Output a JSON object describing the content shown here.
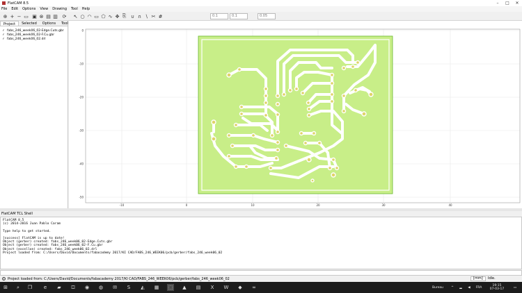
{
  "window": {
    "title": "FlatCAM 8.5"
  },
  "menu": [
    "File",
    "Edit",
    "Options",
    "View",
    "Drawing",
    "Tool",
    "Help"
  ],
  "toolbar": {
    "tools": [
      {
        "name": "zoom-fit-icon",
        "glyph": "⊕"
      },
      {
        "name": "zoom-in-icon",
        "glyph": "+"
      },
      {
        "name": "zoom-out-icon",
        "glyph": "−"
      },
      {
        "name": "replot-icon",
        "glyph": "▭"
      },
      {
        "name": "clear-plot-icon",
        "glyph": "▣"
      },
      {
        "name": "delete-icon",
        "glyph": "⊗"
      },
      {
        "name": "new-geometry-icon",
        "glyph": "▤"
      },
      {
        "name": "edit-geometry-icon",
        "glyph": "▥"
      },
      {
        "name": "update-geometry-icon",
        "glyph": "⟳"
      },
      {
        "name": "select-icon",
        "glyph": "↖"
      },
      {
        "name": "circle-icon",
        "glyph": "○"
      },
      {
        "name": "arc-icon",
        "glyph": "◠"
      },
      {
        "name": "rectangle-icon",
        "glyph": "▭"
      },
      {
        "name": "polygon-icon",
        "glyph": "⬠"
      },
      {
        "name": "path-icon",
        "glyph": "∿"
      },
      {
        "name": "move-icon",
        "glyph": "✥"
      },
      {
        "name": "copy-icon",
        "glyph": "⎘"
      },
      {
        "name": "union-icon",
        "glyph": "∪"
      },
      {
        "name": "intersection-icon",
        "glyph": "∩"
      },
      {
        "name": "subtract-icon",
        "glyph": "∖"
      },
      {
        "name": "cut-icon",
        "glyph": "✂"
      },
      {
        "name": "snap-grid-icon",
        "glyph": "#"
      }
    ],
    "grid_x": "0.1",
    "grid_y": "0.1",
    "snap_max": "0.05"
  },
  "project": {
    "tabs": [
      "Project",
      "Selected",
      "Options",
      "Tool"
    ],
    "items": [
      "fabs_246_week06_02-Edge.Cuts.gbr",
      "fabs_246_week06_02-F.Cu.gbr",
      "fabs_246_week06_02.drl"
    ]
  },
  "plot": {
    "x_ticks": [
      "-10",
      "0",
      "10",
      "20",
      "30",
      "40"
    ],
    "y_ticks": [
      "0",
      "-10",
      "-20",
      "-30",
      "-40",
      "-50"
    ],
    "board_color": "#c8ee88",
    "trace_color": "#ffffff",
    "pad_color": "#e0d36a"
  },
  "shell": {
    "title": "FlatCAM TCL Shell",
    "lines": [
      "FlatCAM 8.5",
      "(c) 2014-2016 Juan Pablo Caram",
      "",
      "Type help to get started.",
      "",
      "[success] FlatCAM is up to date!",
      "Object (gerber) created: fabs_246_week06_02-Edge.Cuts.gbr",
      "Object (gerber) created: fabs_246_week06_02-F.Cu.gbr",
      "Object (excellon) created: fabs_246_week06_02.drl",
      "Project loaded from: C:/Users/David/Documents/fabacademy 2017/KI CAD/FABS_246_WEEK06/pcb/gerber/fabs_246_week06_02"
    ]
  },
  "status": {
    "message": "Project loaded from: C:/Users/David/Documents/fabacademy 2017/KI CAD/FABS_246_WEEK06/pcb/gerber/fabs_246_week06_02",
    "units": "[mm]",
    "state": "Idle."
  },
  "taskbar": {
    "weather": "Bureau",
    "lang": "FRA",
    "time": "19:15",
    "date": "07-03-17"
  }
}
